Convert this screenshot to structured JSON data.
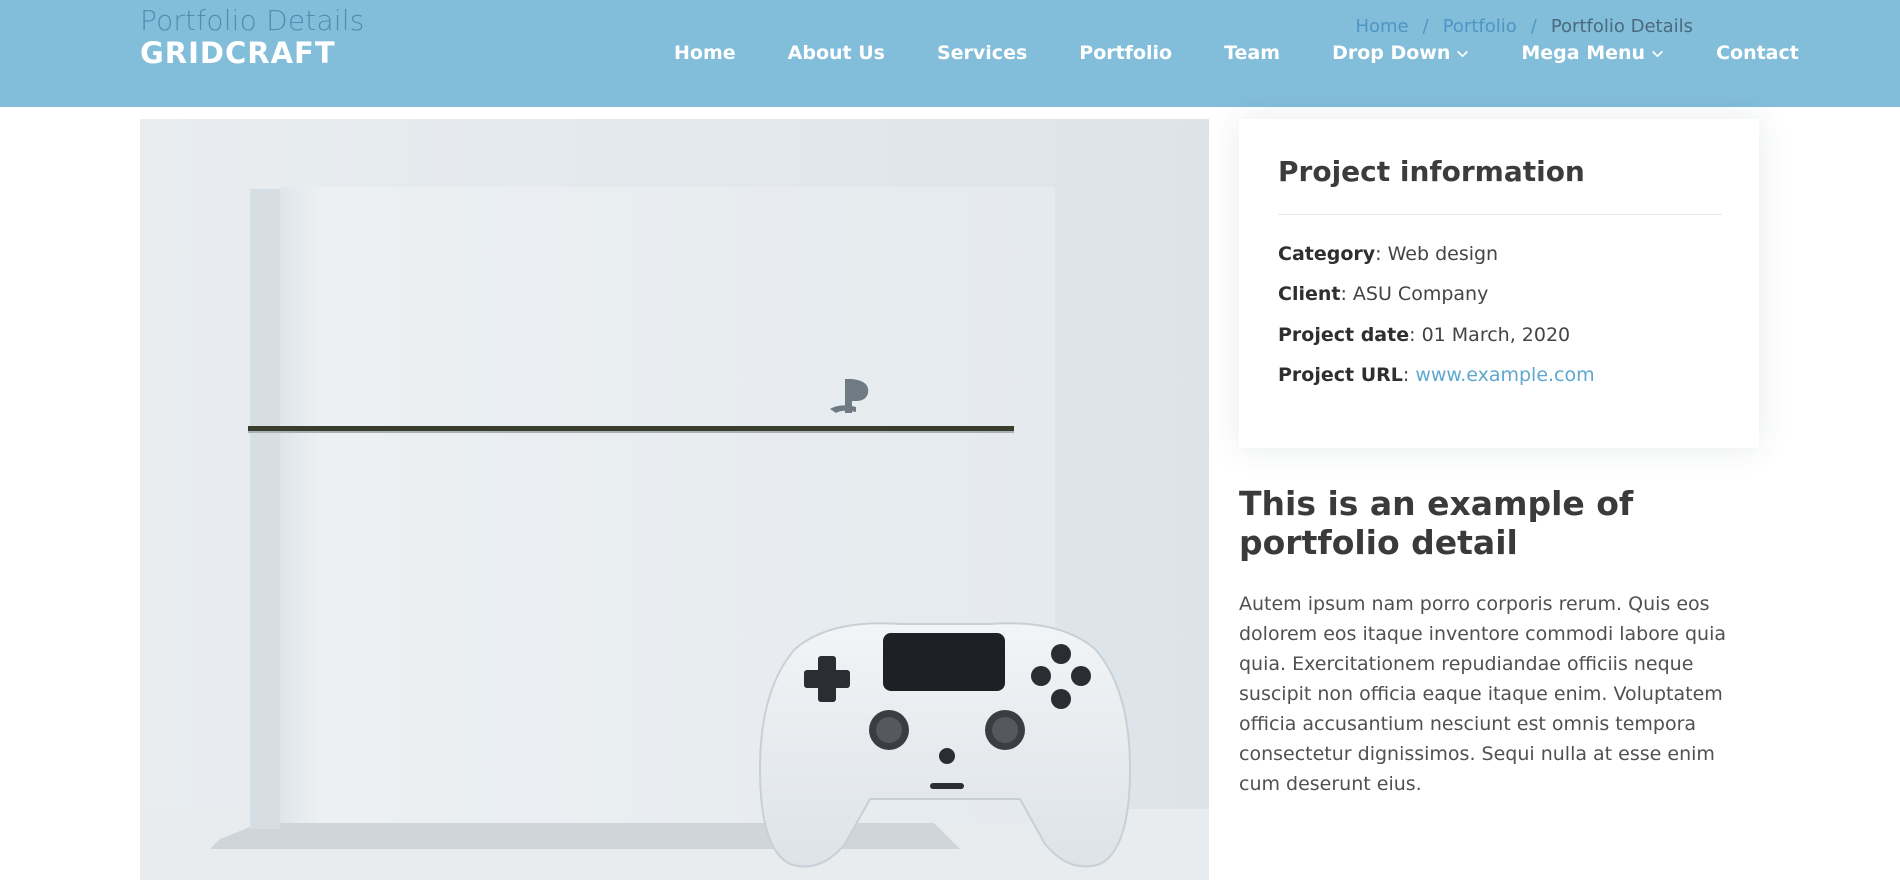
{
  "header": {
    "page_title": "Portfolio Details",
    "logo": "GRIDCRAFT",
    "breadcrumb": {
      "items": [
        "Home",
        "Portfolio"
      ],
      "separator": "/",
      "current": "Portfolio Details"
    },
    "nav": [
      {
        "label": "Home"
      },
      {
        "label": "About Us"
      },
      {
        "label": "Services"
      },
      {
        "label": "Portfolio"
      },
      {
        "label": "Team"
      },
      {
        "label": "Drop Down",
        "icon": "chevron-down-icon"
      },
      {
        "label": "Mega Menu",
        "icon": "chevron-down-icon"
      },
      {
        "label": "Contact"
      }
    ]
  },
  "project_info": {
    "title": "Project information",
    "category_label": "Category",
    "category": "Web design",
    "client_label": "Client",
    "client": "ASU Company",
    "date_label": "Project date",
    "date": "01 March, 2020",
    "url_label": "Project URL",
    "url": "www.example.com"
  },
  "detail": {
    "heading": "This is an example of portfolio detail",
    "text": "Autem ipsum nam porro corporis rerum. Quis eos dolorem eos itaque inventore commodi labore quia quia. Exercitationem repudiandae officiis neque suscipit non officia eaque itaque enim. Voluptatem officia accusantium nesciunt est omnis tempora consectetur dignissimos. Sequi nulla at esse enim cum deserunt eius."
  },
  "colors": {
    "header_bg": "#82bdda",
    "link": "#5ea8cf",
    "heading": "#3a3a3a"
  },
  "image": {
    "icon": "game-console-photo"
  }
}
